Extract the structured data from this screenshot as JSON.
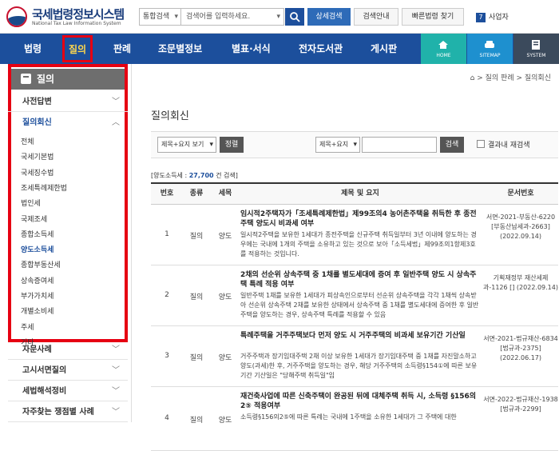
{
  "header": {
    "logo_title": "국세법령정보시스템",
    "logo_subtitle": "National Tax Law Information System",
    "search_select": "통합검색",
    "search_placeholder": "검색어를 입력하세요.",
    "detail_search": "상세검색",
    "search_guide": "검색안내",
    "quick_law": "빠른법령 찾기",
    "site_badge": "7",
    "site_name": "사업자"
  },
  "nav": {
    "items": [
      "법령",
      "질의",
      "판례",
      "조문별정보",
      "별표·서식",
      "전자도서관",
      "게시판"
    ],
    "home": "HOME",
    "sitemap": "SITEMAP",
    "system": "SYSTEM"
  },
  "sidebar": {
    "title": "질의",
    "sec1": "사전답변",
    "sec2": "질의회신",
    "items": [
      "전체",
      "국세기본법",
      "국세징수법",
      "조세특례제한법",
      "법인세",
      "국제조세",
      "종합소득세",
      "양도소득세",
      "종합부동산세",
      "상속증여세",
      "부가가치세",
      "개별소비세",
      "주세",
      "기타"
    ],
    "active_index": 7,
    "after": [
      "자문사례",
      "고시서면질의",
      "세법해석정비",
      "자주찾는 쟁점별 사례"
    ]
  },
  "main": {
    "breadcrumb": [
      "질의 판례",
      "질의회신"
    ],
    "title": "질의회신",
    "opt1": "제목+요지 보기",
    "sort": "정렬",
    "opt2": "제목+요지",
    "search": "검색",
    "in_result": "결과내 재검색",
    "count_prefix": "[양도소득세 : ",
    "count": "27,700",
    "count_suffix": " 건 검색]",
    "cols": [
      "번호",
      "종류",
      "세목",
      "제목 및 요지",
      "문서번호"
    ],
    "rows": [
      {
        "no": "1",
        "kind": "질의",
        "tax": "양도",
        "title": "임시적2주택자가「조세특례제한법」제99조의4 농어촌주택을 취득한 후 종전주택 양도시 비과세 여부",
        "summary": "일시적2주택을 보유한 1세대가 종전주택을 신규주택 취득일부터 3년 이내에 양도하는 경우에는 국내에 1개의 주택을 소유하고 있는 것으로 보아「소득세법」제99조의1항제3호를 적용하는 것입니다.",
        "doc": "서면-2021-부동산-6220 [부동산납세과-2663] (2022.09.14)"
      },
      {
        "no": "2",
        "kind": "질의",
        "tax": "양도",
        "title": "2채의 선순위 상속주택 중 1채를 별도세대에 증여 후 일반주택 양도 시 상속주택 특례 적용 여부",
        "summary": "일반주택 1채를 보유한 1세대가 피상속인으로부터 선순위 상속주택을 각각 1채씩 상속받아 선순위 상속주택 2채를 보유한 상태에서 상속주택 중 1채를 별도세대에 증여한 후 일반주택을 양도하는 경우, 상속주택 특례를 적용할 수 있음",
        "doc": "기획재정부 재산세제과-1126 [] (2022.09.14)"
      },
      {
        "no": "3",
        "kind": "질의",
        "tax": "양도",
        "title": "특례주택을 거주주택보다 먼저 양도 시 거주주택의 비과세 보유기간 기산일",
        "summary": "거주주택과 장기임대주택 2채 이상 보유한 1세대가 장기임대주택 중 1채를 자진말소하고 양도(과세)한 후, 거주주택을 양도하는 경우, 해당 거주주택의 소득령§154①에 따른 보유기간 기산일은 \"당해주택 취득일\"임",
        "doc": "서면-2021-법규재산-6834 [법규과-2375] (2022.06.17)"
      },
      {
        "no": "4",
        "kind": "질의",
        "tax": "양도",
        "title": "재건축사업에 따른 신축주택이 완공된 뒤에 대체주택 취득 시, 소득령 §156의2⑤ 적용여부",
        "summary": "소득령§156의2⑤에 따른 특례는 국내에 1주택을 소유한 1세대가 그 주택에 대한",
        "doc": "서면-2022-법규재산-1938 [법규과-2299]"
      }
    ]
  }
}
